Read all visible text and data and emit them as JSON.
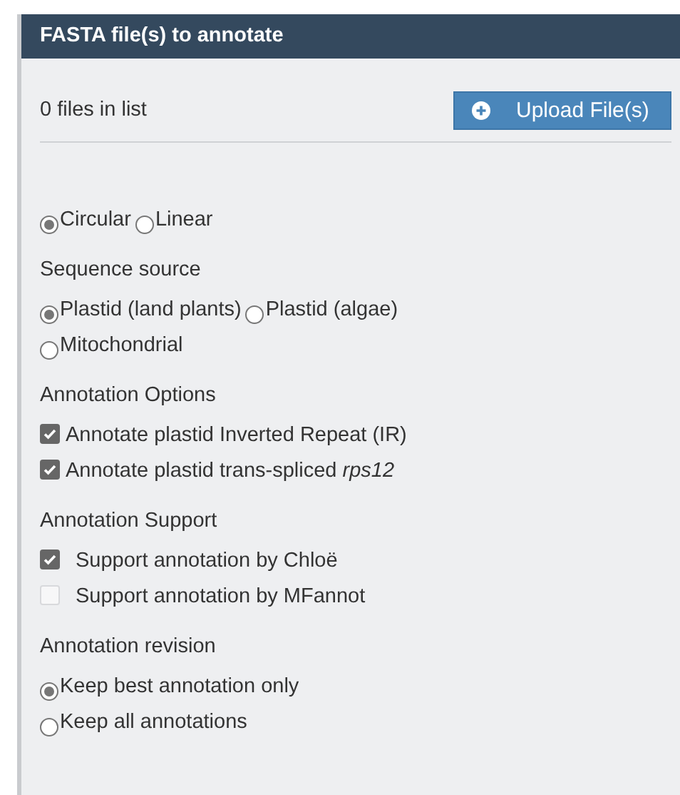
{
  "panel": {
    "title": "FASTA file(s) to annotate"
  },
  "file_count": "0 files in list",
  "upload_button": {
    "label": "Upload File(s)"
  },
  "sections": [
    {
      "kind": "radio",
      "rows": [
        [
          {
            "label": "Circular",
            "selected": true
          },
          {
            "label": "Linear",
            "selected": false
          }
        ]
      ]
    },
    {
      "kind": "radio",
      "heading": "Sequence source",
      "rows": [
        [
          {
            "label": "Plastid (land plants)",
            "selected": true
          },
          {
            "label": "Plastid (algae)",
            "selected": false
          }
        ],
        [
          {
            "label": "Mitochondrial",
            "selected": false
          }
        ]
      ]
    },
    {
      "kind": "checkbox",
      "heading": "Annotation Options",
      "rows": [
        [
          {
            "label": "Annotate plastid Inverted Repeat (IR)",
            "checked": true
          }
        ],
        [
          {
            "label": "Annotate plastid trans-spliced *rps12*",
            "checked": true
          }
        ]
      ]
    },
    {
      "kind": "checkbox",
      "heading": "Annotation Support",
      "rows": [
        [
          {
            "label": "Support annotation by Chloë",
            "checked": true
          }
        ],
        [
          {
            "label": "Support annotation by MFannot",
            "checked": false
          }
        ]
      ]
    },
    {
      "kind": "radio",
      "heading": "Annotation revision",
      "rows": [
        [
          {
            "label": "Keep best annotation only",
            "selected": true
          }
        ],
        [
          {
            "label": "Keep all annotations",
            "selected": false
          }
        ]
      ]
    }
  ]
}
